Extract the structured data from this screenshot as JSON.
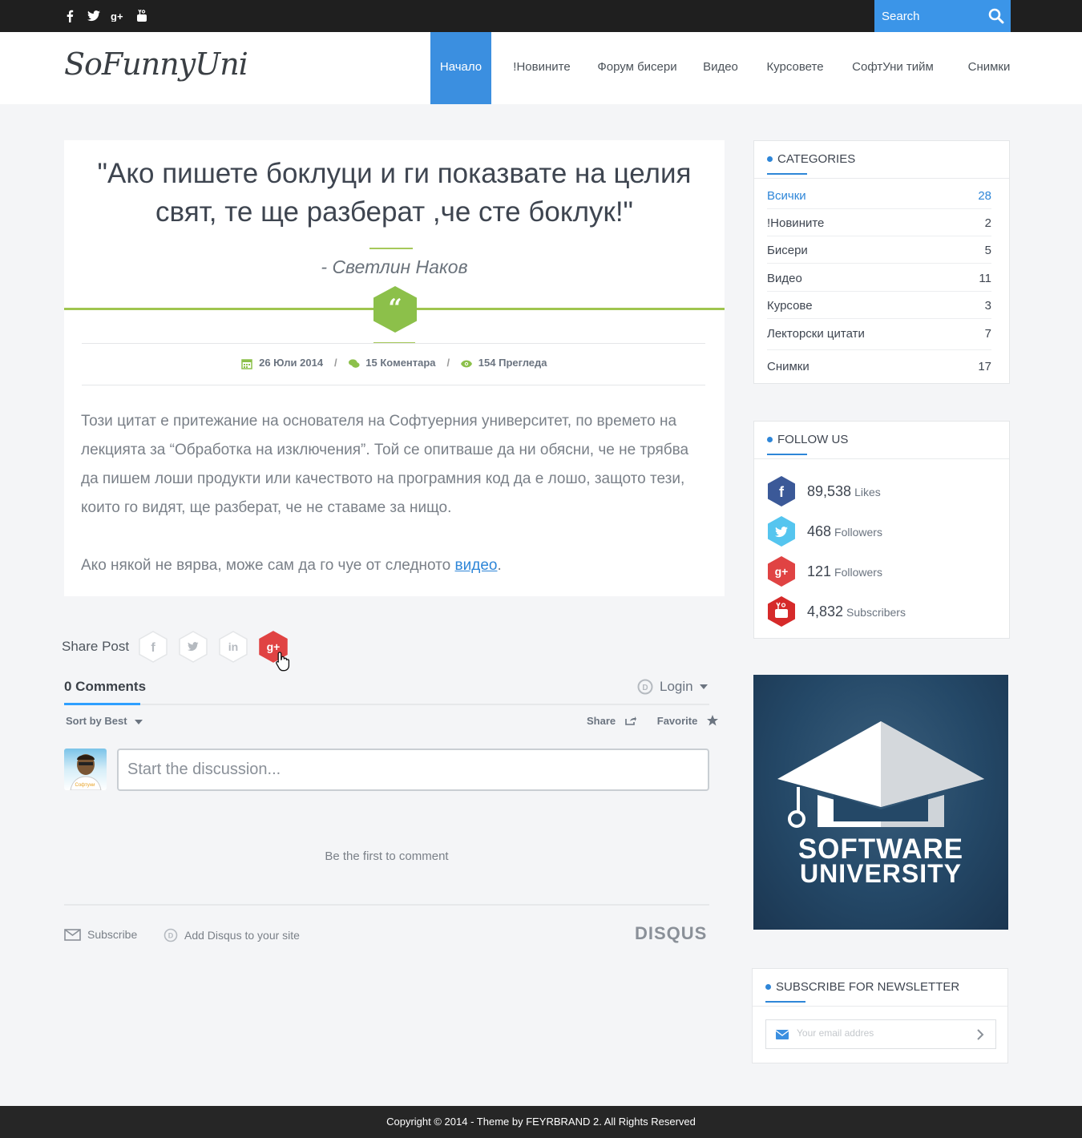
{
  "topbar": {
    "social": [
      "f",
      "t",
      "g+",
      "yt"
    ],
    "search_placeholder": "Search"
  },
  "header": {
    "logo": "SoFunnyUni",
    "nav": [
      {
        "label": "Начало",
        "active": true
      },
      {
        "label": "!Новините",
        "active": false
      },
      {
        "label": "Форум бисери",
        "active": false
      },
      {
        "label": "Видео",
        "active": false
      },
      {
        "label": "Курсовете",
        "active": false
      },
      {
        "label": "СофтУни тийм",
        "active": false
      },
      {
        "label": "Снимки",
        "active": false
      }
    ]
  },
  "post": {
    "quote_line1": "\"Ако пишете боклуци и ги показвате на целия",
    "quote_line2": "свят, те ще разберат ,че сте боклук!\"",
    "author": "- Светлин Наков",
    "date": "26 Юли 2014",
    "comments": "15  Коментара",
    "views": "154  Прегледа",
    "paragraph1": "Този цитат е притежание на основателя на Софтуерния университет, по времето на лекцията за “Обработка на изключения”. Той се опитваше да ни обясни, че не трябва да пишем лоши продукти или качеството на програмния код да е лошо, защото тези, които го видят, ще разберат, че не ставаме за нищо.",
    "paragraph2_pre": "Ако някой не вярва, може сам да го чуе от следното ",
    "paragraph2_link": "видео",
    "paragraph2_post": "."
  },
  "share": {
    "label": "Share Post",
    "colors": {
      "facebook": "#ffffff",
      "twitter": "#ffffff",
      "linkedin": "#ffffff",
      "googleplus": "#e04343"
    }
  },
  "disqus": {
    "count": "0 Comments",
    "login": "Login",
    "sort": "Sort by Best",
    "share": "Share",
    "favorite": "Favorite",
    "placeholder": "Start the discussion...",
    "first": "Be the first to comment",
    "subscribe": "Subscribe",
    "add": "Add Disqus to your site",
    "logo": "DISQUS"
  },
  "categories": {
    "title": "CATEGORIES",
    "items": [
      {
        "label": "Всички",
        "count": "28"
      },
      {
        "label": "!Новините",
        "count": "2"
      },
      {
        "label": "Бисери",
        "count": "5"
      },
      {
        "label": "Видео",
        "count": "11"
      },
      {
        "label": "Курсове",
        "count": "3"
      },
      {
        "label": "Лекторски цитати",
        "count": "7"
      },
      {
        "label": "Снимки",
        "count": "17"
      }
    ]
  },
  "follow": {
    "title": "FOLLOW US",
    "items": [
      {
        "num": "89,538",
        "label": "Likes",
        "color": "#3b5998"
      },
      {
        "num": "468",
        "label": "Followers",
        "color": "#55c5ef"
      },
      {
        "num": "121",
        "label": "Followers",
        "color": "#e04343"
      },
      {
        "num": "4,832",
        "label": "Subscribers",
        "color": "#d62a2a"
      }
    ]
  },
  "banner": {
    "line1": "SOFTWARE",
    "line2": "UNIVERSITY"
  },
  "newsletter": {
    "title": "SUBSCRIBE FOR NEWSLETTER",
    "placeholder": "Your email addres"
  },
  "footer": {
    "text": "Copyright © 2014 - Theme by FEYRBRAND 2. All Rights Reserved"
  },
  "colors": {
    "accent": "#3b8fe0",
    "green": "#9fc54f",
    "topbar": "#1f1f1f"
  }
}
